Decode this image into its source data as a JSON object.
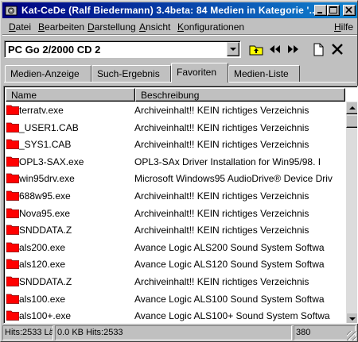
{
  "window": {
    "title": "Kat-CeDe (Ralf Biedermann) 3.4beta: 84 Medien in Kategorie '..."
  },
  "menu": {
    "left": [
      {
        "first": "D",
        "rest": "atei"
      },
      {
        "first": "B",
        "rest": "earbeiten"
      },
      {
        "first": "D",
        "rest": "arstellung"
      },
      {
        "first": "A",
        "rest": "nsicht"
      },
      {
        "first": "K",
        "rest": "onfigurationen"
      }
    ],
    "help": {
      "first": "H",
      "rest": "ilfe"
    }
  },
  "media_selector": {
    "value": "PC Go 2/2000 CD 2"
  },
  "toolbar": {
    "icons": [
      "folder-up-icon",
      "rewind-icon",
      "fast-forward-icon",
      "new-document-icon",
      "close-x-icon"
    ]
  },
  "tabs": [
    {
      "label": "Medien-Anzeige",
      "active": false
    },
    {
      "label": "Such-Ergebnis",
      "active": false
    },
    {
      "label": "Favoriten",
      "active": true
    },
    {
      "label": "Medien-Liste",
      "active": false
    }
  ],
  "list": {
    "columns": {
      "name": "Name",
      "description": "Beschreibung"
    },
    "rows": [
      {
        "name": "terratv.exe",
        "desc": "Archiveinhalt!! KEIN richtiges Verzeichnis"
      },
      {
        "name": "_USER1.CAB",
        "desc": "Archiveinhalt!! KEIN richtiges Verzeichnis"
      },
      {
        "name": "_SYS1.CAB",
        "desc": "Archiveinhalt!! KEIN richtiges Verzeichnis"
      },
      {
        "name": "OPL3-SAX.exe",
        "desc": "OPL3-SAx Driver Installation for Win95/98.    I"
      },
      {
        "name": "win95drv.exe",
        "desc": "Microsoft Windows95 AudioDrive® Device Driv"
      },
      {
        "name": "688w95.exe",
        "desc": "Archiveinhalt!! KEIN richtiges Verzeichnis"
      },
      {
        "name": "Nova95.exe",
        "desc": "Archiveinhalt!! KEIN richtiges Verzeichnis"
      },
      {
        "name": "SNDDATA.Z",
        "desc": "Archiveinhalt!! KEIN richtiges Verzeichnis"
      },
      {
        "name": "als200.exe",
        "desc": " Avance Logic ALS200 Sound System Softwa"
      },
      {
        "name": "als120.exe",
        "desc": " Avance Logic ALS120 Sound System Softwa"
      },
      {
        "name": "SNDDATA.Z",
        "desc": "Archiveinhalt!! KEIN richtiges Verzeichnis"
      },
      {
        "name": "als100.exe",
        "desc": " Avance Logic ALS100 Sound System Softwa"
      },
      {
        "name": "als100+.exe",
        "desc": " Avance Logic ALS100+ Sound System Softwa"
      }
    ]
  },
  "status": {
    "hits1": "Hits:2533 Lä",
    "hits2": "0.0 KB Hits:2533",
    "count": "380"
  },
  "colors": {
    "title_start": "#000080",
    "title_end": "#1084d0",
    "folder_red": "#ff0000"
  }
}
